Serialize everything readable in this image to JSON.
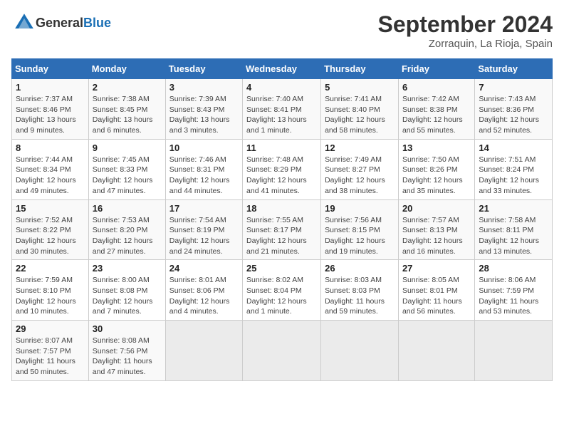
{
  "header": {
    "logo_general": "General",
    "logo_blue": "Blue",
    "month_year": "September 2024",
    "location": "Zorraquin, La Rioja, Spain"
  },
  "weekdays": [
    "Sunday",
    "Monday",
    "Tuesday",
    "Wednesday",
    "Thursday",
    "Friday",
    "Saturday"
  ],
  "weeks": [
    [
      {
        "day": "1",
        "sunrise": "Sunrise: 7:37 AM",
        "sunset": "Sunset: 8:46 PM",
        "daylight": "Daylight: 13 hours and 9 minutes."
      },
      {
        "day": "2",
        "sunrise": "Sunrise: 7:38 AM",
        "sunset": "Sunset: 8:45 PM",
        "daylight": "Daylight: 13 hours and 6 minutes."
      },
      {
        "day": "3",
        "sunrise": "Sunrise: 7:39 AM",
        "sunset": "Sunset: 8:43 PM",
        "daylight": "Daylight: 13 hours and 3 minutes."
      },
      {
        "day": "4",
        "sunrise": "Sunrise: 7:40 AM",
        "sunset": "Sunset: 8:41 PM",
        "daylight": "Daylight: 13 hours and 1 minute."
      },
      {
        "day": "5",
        "sunrise": "Sunrise: 7:41 AM",
        "sunset": "Sunset: 8:40 PM",
        "daylight": "Daylight: 12 hours and 58 minutes."
      },
      {
        "day": "6",
        "sunrise": "Sunrise: 7:42 AM",
        "sunset": "Sunset: 8:38 PM",
        "daylight": "Daylight: 12 hours and 55 minutes."
      },
      {
        "day": "7",
        "sunrise": "Sunrise: 7:43 AM",
        "sunset": "Sunset: 8:36 PM",
        "daylight": "Daylight: 12 hours and 52 minutes."
      }
    ],
    [
      {
        "day": "8",
        "sunrise": "Sunrise: 7:44 AM",
        "sunset": "Sunset: 8:34 PM",
        "daylight": "Daylight: 12 hours and 49 minutes."
      },
      {
        "day": "9",
        "sunrise": "Sunrise: 7:45 AM",
        "sunset": "Sunset: 8:33 PM",
        "daylight": "Daylight: 12 hours and 47 minutes."
      },
      {
        "day": "10",
        "sunrise": "Sunrise: 7:46 AM",
        "sunset": "Sunset: 8:31 PM",
        "daylight": "Daylight: 12 hours and 44 minutes."
      },
      {
        "day": "11",
        "sunrise": "Sunrise: 7:48 AM",
        "sunset": "Sunset: 8:29 PM",
        "daylight": "Daylight: 12 hours and 41 minutes."
      },
      {
        "day": "12",
        "sunrise": "Sunrise: 7:49 AM",
        "sunset": "Sunset: 8:27 PM",
        "daylight": "Daylight: 12 hours and 38 minutes."
      },
      {
        "day": "13",
        "sunrise": "Sunrise: 7:50 AM",
        "sunset": "Sunset: 8:26 PM",
        "daylight": "Daylight: 12 hours and 35 minutes."
      },
      {
        "day": "14",
        "sunrise": "Sunrise: 7:51 AM",
        "sunset": "Sunset: 8:24 PM",
        "daylight": "Daylight: 12 hours and 33 minutes."
      }
    ],
    [
      {
        "day": "15",
        "sunrise": "Sunrise: 7:52 AM",
        "sunset": "Sunset: 8:22 PM",
        "daylight": "Daylight: 12 hours and 30 minutes."
      },
      {
        "day": "16",
        "sunrise": "Sunrise: 7:53 AM",
        "sunset": "Sunset: 8:20 PM",
        "daylight": "Daylight: 12 hours and 27 minutes."
      },
      {
        "day": "17",
        "sunrise": "Sunrise: 7:54 AM",
        "sunset": "Sunset: 8:19 PM",
        "daylight": "Daylight: 12 hours and 24 minutes."
      },
      {
        "day": "18",
        "sunrise": "Sunrise: 7:55 AM",
        "sunset": "Sunset: 8:17 PM",
        "daylight": "Daylight: 12 hours and 21 minutes."
      },
      {
        "day": "19",
        "sunrise": "Sunrise: 7:56 AM",
        "sunset": "Sunset: 8:15 PM",
        "daylight": "Daylight: 12 hours and 19 minutes."
      },
      {
        "day": "20",
        "sunrise": "Sunrise: 7:57 AM",
        "sunset": "Sunset: 8:13 PM",
        "daylight": "Daylight: 12 hours and 16 minutes."
      },
      {
        "day": "21",
        "sunrise": "Sunrise: 7:58 AM",
        "sunset": "Sunset: 8:11 PM",
        "daylight": "Daylight: 12 hours and 13 minutes."
      }
    ],
    [
      {
        "day": "22",
        "sunrise": "Sunrise: 7:59 AM",
        "sunset": "Sunset: 8:10 PM",
        "daylight": "Daylight: 12 hours and 10 minutes."
      },
      {
        "day": "23",
        "sunrise": "Sunrise: 8:00 AM",
        "sunset": "Sunset: 8:08 PM",
        "daylight": "Daylight: 12 hours and 7 minutes."
      },
      {
        "day": "24",
        "sunrise": "Sunrise: 8:01 AM",
        "sunset": "Sunset: 8:06 PM",
        "daylight": "Daylight: 12 hours and 4 minutes."
      },
      {
        "day": "25",
        "sunrise": "Sunrise: 8:02 AM",
        "sunset": "Sunset: 8:04 PM",
        "daylight": "Daylight: 12 hours and 1 minute."
      },
      {
        "day": "26",
        "sunrise": "Sunrise: 8:03 AM",
        "sunset": "Sunset: 8:03 PM",
        "daylight": "Daylight: 11 hours and 59 minutes."
      },
      {
        "day": "27",
        "sunrise": "Sunrise: 8:05 AM",
        "sunset": "Sunset: 8:01 PM",
        "daylight": "Daylight: 11 hours and 56 minutes."
      },
      {
        "day": "28",
        "sunrise": "Sunrise: 8:06 AM",
        "sunset": "Sunset: 7:59 PM",
        "daylight": "Daylight: 11 hours and 53 minutes."
      }
    ],
    [
      {
        "day": "29",
        "sunrise": "Sunrise: 8:07 AM",
        "sunset": "Sunset: 7:57 PM",
        "daylight": "Daylight: 11 hours and 50 minutes."
      },
      {
        "day": "30",
        "sunrise": "Sunrise: 8:08 AM",
        "sunset": "Sunset: 7:56 PM",
        "daylight": "Daylight: 11 hours and 47 minutes."
      },
      null,
      null,
      null,
      null,
      null
    ]
  ]
}
